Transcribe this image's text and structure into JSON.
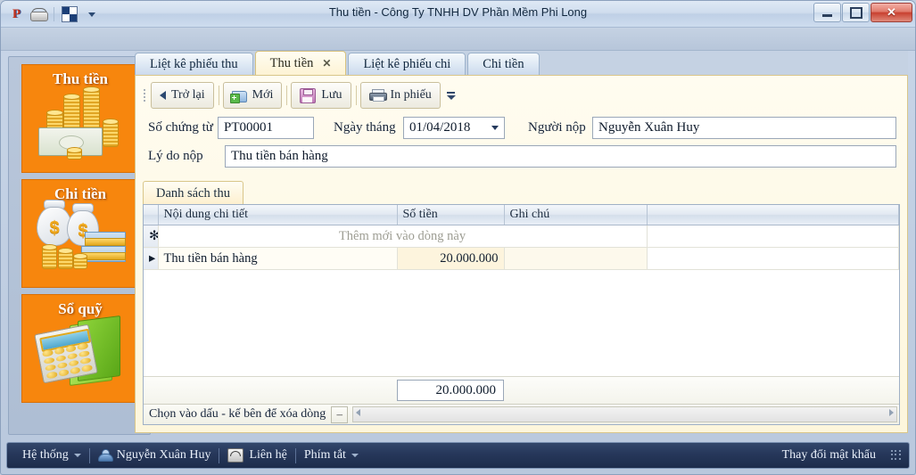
{
  "window": {
    "title": "Thu tiền - Công Ty TNHH DV Phần Mềm Phi Long",
    "quick_access": [
      "app-icon",
      "phone-icon",
      "window-icon",
      "dropdown-caret"
    ],
    "buttons": {
      "minimize": "—",
      "maximize": "❐",
      "close": "✕"
    }
  },
  "sidebar": {
    "tiles": [
      {
        "label": "Thu tiền",
        "icon": "coins-and-banknote-icon",
        "color": "#f7860d"
      },
      {
        "label": "Chi tiền",
        "icon": "money-bags-icon",
        "color": "#f7860d"
      },
      {
        "label": "Sổ quỹ",
        "icon": "calculator-and-book-icon",
        "color": "#f7860d"
      }
    ]
  },
  "tabs": [
    {
      "label": "Liệt kê phiếu thu",
      "active": false,
      "closable": false
    },
    {
      "label": "Thu tiền",
      "active": true,
      "closable": true,
      "close_glyph": "✕"
    },
    {
      "label": "Liệt kê phiếu chi",
      "active": false,
      "closable": false
    },
    {
      "label": "Chi tiền",
      "active": false,
      "closable": false
    }
  ],
  "toolbar": {
    "back_label": "Trở lại",
    "new_label": "Mới",
    "save_label": "Lưu",
    "print_label": "In phiếu"
  },
  "form": {
    "voucher_no_label": "Số chứng từ",
    "voucher_no_value": "PT00001",
    "date_label": "Ngày tháng",
    "date_value": "01/04/2018",
    "payer_label": "Người nộp",
    "payer_value": "Nguyễn Xuân Huy",
    "reason_label": "Lý do nộp",
    "reason_value": "Thu tiền bán hàng"
  },
  "grid": {
    "tab_label": "Danh sách thu",
    "columns": [
      "Nội dung chi tiết",
      "Số tiền",
      "Ghi chú"
    ],
    "new_row_text": "Thêm mới vào dòng này",
    "new_row_marker": "✻",
    "current_row_marker": "▸",
    "rows": [
      {
        "name": "Thu tiền bán hàng",
        "amount": "20.000.000",
        "note": ""
      }
    ],
    "total": "20.000.000",
    "status_text": "Chọn vào dấu - kế bên để xóa dòng",
    "delete_glyph": "–"
  },
  "statusbar": {
    "system_label": "Hệ thống",
    "user_label": "Nguyễn Xuân Huy",
    "contact_label": "Liên hệ",
    "shortcut_label": "Phím tắt",
    "change_password_label": "Thay đổi mật khẩu"
  }
}
